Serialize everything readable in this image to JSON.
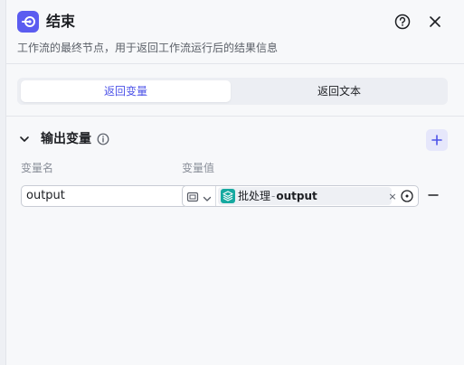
{
  "header": {
    "title": "结束",
    "description": "工作流的最终节点，用于返回工作流运行后的结果信息",
    "node_icon": "end-node-icon",
    "help_icon": "help-circle-icon",
    "close_icon": "close-icon"
  },
  "tabs": [
    {
      "label": "返回变量",
      "active": true
    },
    {
      "label": "返回文本",
      "active": false
    }
  ],
  "output_section": {
    "title": "输出变量",
    "info_icon": "info-icon",
    "add_icon": "plus-icon",
    "columns": {
      "name": "变量名",
      "value": "变量值"
    },
    "rows": [
      {
        "name": "output",
        "value_type_icon": "reference-type-icon",
        "ref_node": "批处理",
        "ref_separator": "-",
        "ref_var": "output",
        "clear_label": "×"
      }
    ]
  },
  "colors": {
    "accent": "#4d53e8",
    "node_icon_bg": "#5b5cf0",
    "batch_icon_bg": "#16a9a0"
  }
}
